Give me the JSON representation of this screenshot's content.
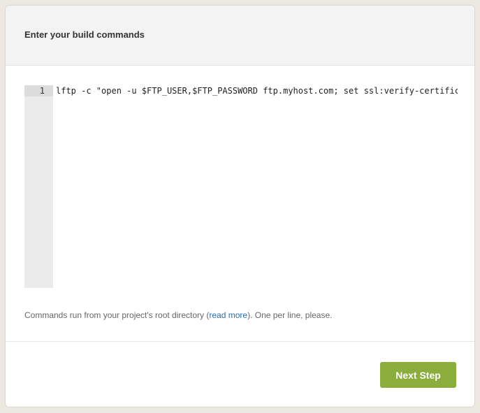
{
  "header": {
    "title": "Enter your build commands"
  },
  "editor": {
    "lines": [
      {
        "number": "1",
        "text": "lftp -c \"open -u $FTP_USER,$FTP_PASSWORD ftp.myhost.com; set ssl:verify-certific"
      }
    ]
  },
  "help": {
    "text_before": "Commands run from your project's root directory (",
    "link_label": "read more",
    "text_after": "). One per line, please."
  },
  "footer": {
    "next_label": "Next Step"
  },
  "colors": {
    "accent_button": "#8aad3b",
    "link": "#2a6db0"
  }
}
